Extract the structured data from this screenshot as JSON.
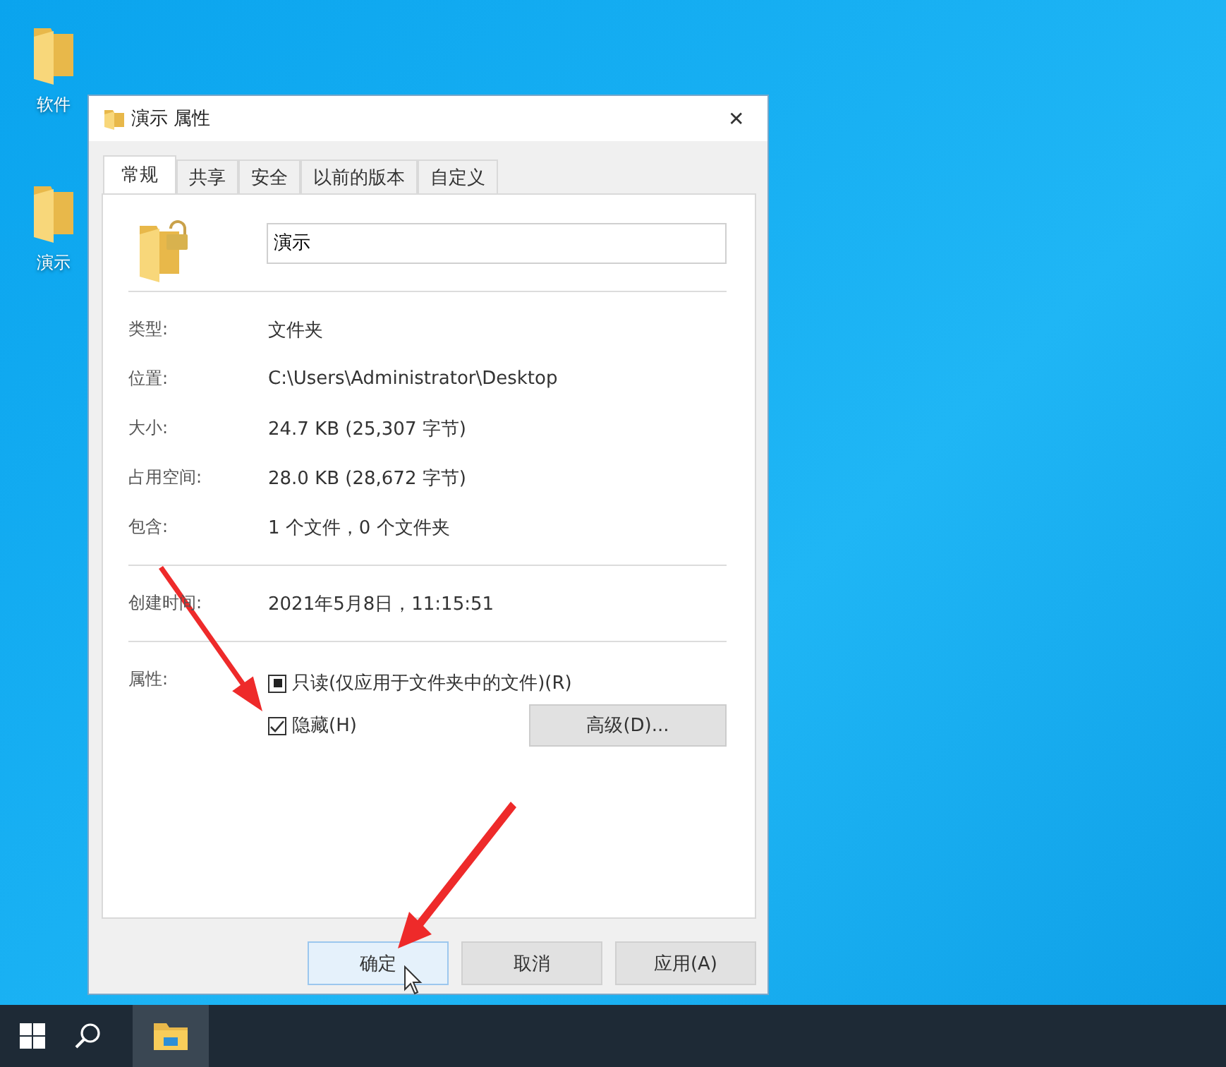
{
  "desktop_icons": [
    {
      "label": "软件"
    },
    {
      "label": "演示"
    }
  ],
  "window": {
    "title": "演示 属性",
    "close": "✕"
  },
  "tabs": [
    {
      "label": "常规",
      "selected": true
    },
    {
      "label": "共享",
      "selected": false
    },
    {
      "label": "安全",
      "selected": false
    },
    {
      "label": "以前的版本",
      "selected": false
    },
    {
      "label": "自定义",
      "selected": false
    }
  ],
  "name_field": {
    "value": "演示"
  },
  "info_groups": [
    [
      {
        "label": "类型:",
        "value": "文件夹"
      },
      {
        "label": "位置:",
        "value": "C:\\Users\\Administrator\\Desktop"
      },
      {
        "label": "大小:",
        "value": "24.7 KB (25,307 字节)"
      },
      {
        "label": "占用空间:",
        "value": "28.0 KB (28,672 字节)"
      },
      {
        "label": "包含:",
        "value": "1 个文件，0 个文件夹"
      }
    ],
    [
      {
        "label": "创建时间:",
        "value": "2021年5月8日，11:15:51"
      }
    ]
  ],
  "attributes": {
    "label": "属性:",
    "checkboxes": [
      {
        "label": "只读(仅应用于文件夹中的文件)(R)",
        "indeterminate": true
      },
      {
        "label": "隐藏(H)",
        "checked": true
      }
    ],
    "advanced_button": "高级(D)..."
  },
  "buttons": [
    {
      "label": "确定",
      "focused": true
    },
    {
      "label": "取消",
      "focused": false
    },
    {
      "label": "应用(A)",
      "focused": false
    }
  ]
}
